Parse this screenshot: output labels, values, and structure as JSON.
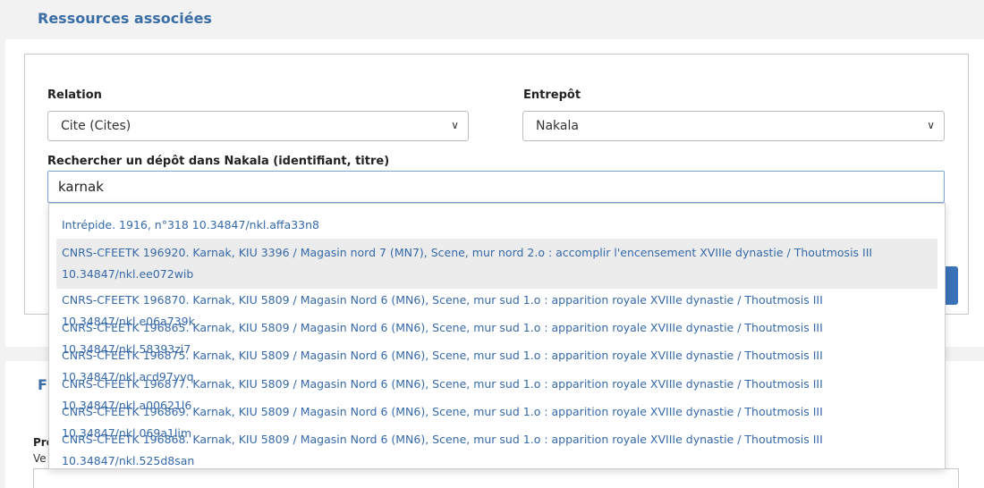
{
  "section": {
    "title": "Ressources associées"
  },
  "form": {
    "relation_label": "Relation",
    "relation_value": "Cite (Cites)",
    "repository_label": "Entrepôt",
    "repository_value": "Nakala",
    "search_label": "Rechercher un dépôt dans Nakala (identifiant, titre)",
    "search_value": "karnak"
  },
  "dropdown": {
    "cut_text": "...",
    "items": [
      {
        "line1": "Intrépide. 1916, n°318 10.34847/nkl.affa33n8",
        "line2": ""
      },
      {
        "line1": "CNRS-CFEETK 196920. Karnak, KIU 3396 / Magasin nord 7 (MN7), Scene, mur nord 2.o : accomplir l'encensement XVIIIe dynastie / Thoutmosis III",
        "line2": "10.34847/nkl.ee072wib"
      },
      {
        "line1": "CNRS-CFEETK 196870. Karnak, KIU 5809 / Magasin Nord 6 (MN6), Scene, mur sud 1.o : apparition royale XVIIIe dynastie / Thoutmosis III 10.34847/nkl.e06a739k",
        "line2": ""
      },
      {
        "line1": "CNRS-CFEETK 196865. Karnak, KIU 5809 / Magasin Nord 6 (MN6), Scene, mur sud 1.o : apparition royale XVIIIe dynastie / Thoutmosis III 10.34847/nkl.58393zi7",
        "line2": ""
      },
      {
        "line1": "CNRS-CFEETK 196875. Karnak, KIU 5809 / Magasin Nord 6 (MN6), Scene, mur sud 1.o : apparition royale XVIIIe dynastie / Thoutmosis III 10.34847/nkl.acd97yvq",
        "line2": ""
      },
      {
        "line1": "CNRS-CFEETK 196877. Karnak, KIU 5809 / Magasin Nord 6 (MN6), Scene, mur sud 1.o : apparition royale XVIIIe dynastie / Thoutmosis III 10.34847/nkl.a00621l6",
        "line2": ""
      },
      {
        "line1": "CNRS-CFEETK 196869. Karnak, KIU 5809 / Magasin Nord 6 (MN6), Scene, mur sud 1.o : apparition royale XVIIIe dynastie / Thoutmosis III 10.34847/nkl.069a1lim",
        "line2": ""
      },
      {
        "line1": "CNRS-CFEETK 196868. Karnak, KIU 5809 / Magasin Nord 6 (MN6), Scene, mur sud 1.o : apparition royale XVIIIe dynastie / Thoutmosis III",
        "line2": "10.34847/nkl.525d8san"
      }
    ]
  },
  "next_section": {
    "title": "Fi",
    "label": "Pro",
    "sub": "Ve"
  },
  "colors": {
    "accent": "#3a6ea5",
    "link": "#3569a8",
    "button": "#3a73b8",
    "highlight": "#ececec"
  }
}
